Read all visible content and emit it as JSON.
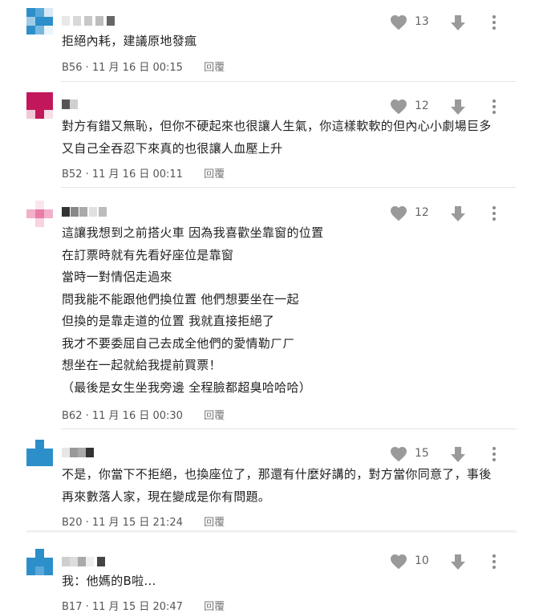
{
  "comments": [
    {
      "avatar_color": "#2c8fc9",
      "likes": "13",
      "lines": [
        "拒絕內耗，建議原地發瘋"
      ],
      "floor": "B56",
      "time": "11 月 16 日 00:15",
      "reply_label": "回覆"
    },
    {
      "avatar_color": "#c2185b",
      "likes": "12",
      "lines": [
        "對方有錯又無恥，但你不硬起來也很讓人生氣，你這樣軟軟的但內心小劇場巨多",
        "又自己全吞忍下來真的也很讓人血壓上升"
      ],
      "floor": "B52",
      "time": "11 月 16 日 00:11",
      "reply_label": "回覆"
    },
    {
      "avatar_color": "#e87da8",
      "likes": "12",
      "lines": [
        "這讓我想到之前搭火車 因為我喜歡坐靠窗的位置",
        "在訂票時就有先看好座位是靠窗",
        "當時一對情侶走過來",
        "問我能不能跟他們換位置 他們想要坐在一起",
        "但換的是靠走道的位置 我就直接拒絕了",
        "我才不要委屈自己去成全他們的愛情勒ㄏㄏ",
        "想坐在一起就給我提前買票！",
        "（最後是女生坐我旁邊 全程臉都超臭哈哈哈）"
      ],
      "floor": "B62",
      "time": "11 月 16 日 00:30",
      "reply_label": "回覆"
    },
    {
      "avatar_color": "#2c8fc9",
      "likes": "15",
      "lines": [
        "不是，你當下不拒絕，也換座位了，那還有什麼好講的，對方當你同意了，事後",
        "再來數落人家，現在變成是你有問題。"
      ],
      "floor": "B20",
      "time": "11 月 15 日 21:24",
      "reply_label": "回覆"
    },
    {
      "avatar_color": "#2c8fc9",
      "likes": "10",
      "lines": [
        "我：他媽的B啦..."
      ],
      "floor": "B17",
      "time": "11 月 15 日 20:47",
      "reply_label": "回覆"
    }
  ]
}
